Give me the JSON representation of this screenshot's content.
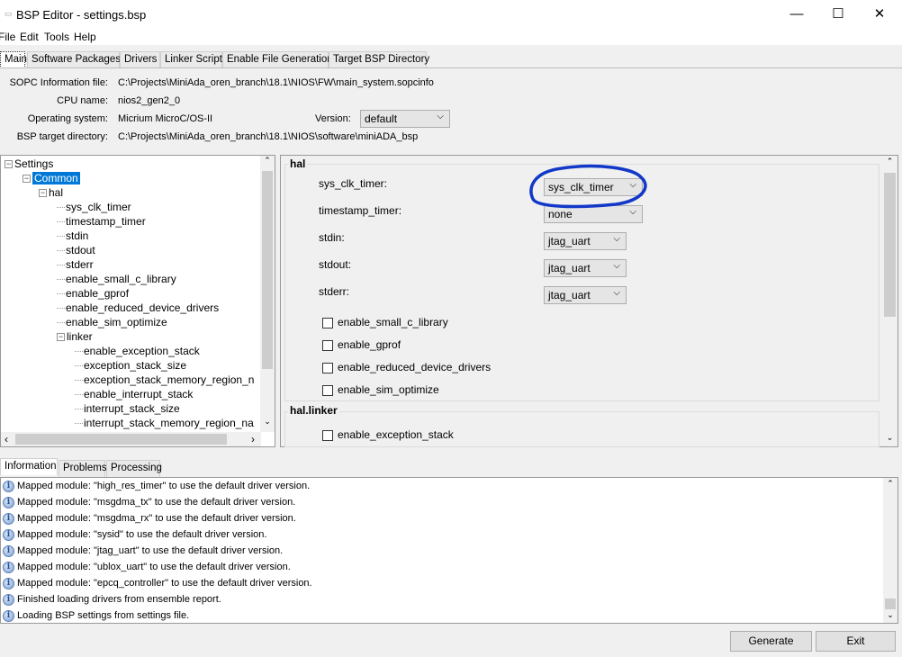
{
  "window": {
    "title": "BSP Editor - settings.bsp",
    "minimize": "—",
    "maximize": "☐",
    "close": "✕"
  },
  "menu": [
    "File",
    "Edit",
    "Tools",
    "Help"
  ],
  "tabs": [
    "Main",
    "Software Packages",
    "Drivers",
    "Linker Script",
    "Enable File Generation",
    "Target BSP Directory"
  ],
  "main": {
    "sopc_label": "SOPC Information file:",
    "sopc_value": "C:\\Projects\\MiniAda_oren_branch\\18.1\\NIOS\\FW\\main_system.sopcinfo",
    "cpu_label": "CPU name:",
    "cpu_value": "nios2_gen2_0",
    "os_label": "Operating system:",
    "os_value": "Micrium MicroC/OS-II",
    "version_label": "Version:",
    "version_value": "default",
    "bsp_dir_label": "BSP target directory:",
    "bsp_dir_value": "C:\\Projects\\MiniAda_oren_branch\\18.1\\NIOS\\software\\miniADA_bsp"
  },
  "tree": [
    {
      "label": "Settings",
      "level": 0,
      "expander": "−"
    },
    {
      "label": "Common",
      "level": 1,
      "expander": "−",
      "selected": true
    },
    {
      "label": "hal",
      "level": 2,
      "expander": "−"
    },
    {
      "label": "sys_clk_timer",
      "level": 3
    },
    {
      "label": "timestamp_timer",
      "level": 3
    },
    {
      "label": "stdin",
      "level": 3
    },
    {
      "label": "stdout",
      "level": 3
    },
    {
      "label": "stderr",
      "level": 3
    },
    {
      "label": "enable_small_c_library",
      "level": 3
    },
    {
      "label": "enable_gprof",
      "level": 3
    },
    {
      "label": "enable_reduced_device_drivers",
      "level": 3
    },
    {
      "label": "enable_sim_optimize",
      "level": 3
    },
    {
      "label": "linker",
      "level": 3,
      "expander": "−"
    },
    {
      "label": "enable_exception_stack",
      "level": 4
    },
    {
      "label": "exception_stack_size",
      "level": 4
    },
    {
      "label": "exception_stack_memory_region_n",
      "level": 4
    },
    {
      "label": "enable_interrupt_stack",
      "level": 4
    },
    {
      "label": "interrupt_stack_size",
      "level": 4
    },
    {
      "label": "interrupt_stack_memory_region_na",
      "level": 4
    }
  ],
  "hal": {
    "title": "hal",
    "fields": [
      {
        "label": "sys_clk_timer:",
        "value": "sys_clk_timer"
      },
      {
        "label": "timestamp_timer:",
        "value": "none"
      },
      {
        "label": "stdin:",
        "value": "jtag_uart"
      },
      {
        "label": "stdout:",
        "value": "jtag_uart"
      },
      {
        "label": "stderr:",
        "value": "jtag_uart"
      }
    ],
    "checkboxes": [
      {
        "label": "enable_small_c_library",
        "checked": false
      },
      {
        "label": "enable_gprof",
        "checked": false
      },
      {
        "label": "enable_reduced_device_drivers",
        "checked": false
      },
      {
        "label": "enable_sim_optimize",
        "checked": false
      }
    ]
  },
  "hal_linker": {
    "title": "hal.linker",
    "checkboxes": [
      {
        "label": "enable_exception_stack",
        "checked": false
      }
    ]
  },
  "annotation_color": "#1238c8",
  "bottom_tabs": [
    "Information",
    "Problems",
    "Processing"
  ],
  "log": [
    "Mapped module: \"high_res_timer\" to use the default driver version.",
    "Mapped module: \"msgdma_tx\" to use the default driver version.",
    "Mapped module: \"msgdma_rx\" to use the default driver version.",
    "Mapped module: \"sysid\" to use the default driver version.",
    "Mapped module: \"jtag_uart\" to use the default driver version.",
    "Mapped module: \"ublox_uart\" to use the default driver version.",
    "Mapped module: \"epcq_controller\" to use the default driver version.",
    "Finished loading drivers from ensemble report.",
    "Loading BSP settings from settings file."
  ],
  "buttons": {
    "generate": "Generate",
    "exit": "Exit"
  }
}
